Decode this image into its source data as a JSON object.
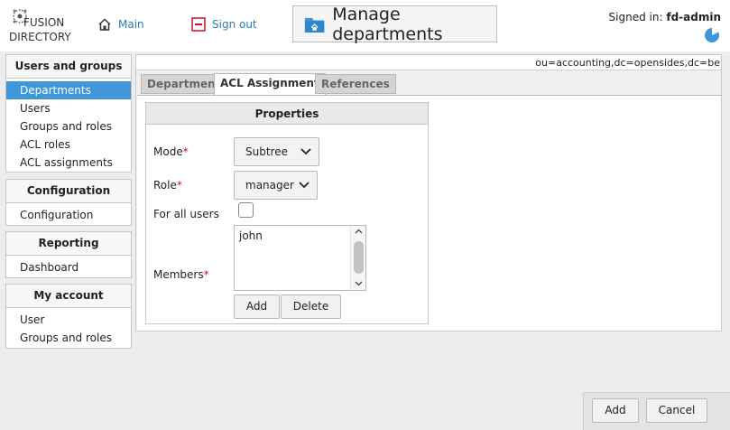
{
  "header": {
    "logo": {
      "line1": "FUSION",
      "line2": "DIRECTORY"
    },
    "main_link": {
      "label": "Main",
      "icon": "home-icon"
    },
    "signout_link": {
      "label": "Sign out",
      "icon": "sign-out-icon"
    },
    "page_title": {
      "label": "Manage departments",
      "icon": "folder-home-icon"
    },
    "signed_in_label": "Signed in:",
    "signed_in_user": "fd-admin",
    "timer_icon": "clock-icon"
  },
  "sidebar": [
    {
      "title": "Users and groups",
      "items": [
        {
          "label": "Departments",
          "active": true
        },
        {
          "label": "Users"
        },
        {
          "label": "Groups and roles"
        },
        {
          "label": "ACL roles"
        },
        {
          "label": "ACL assignments"
        }
      ]
    },
    {
      "title": "Configuration",
      "items": [
        {
          "label": "Configuration"
        }
      ]
    },
    {
      "title": "Reporting",
      "items": [
        {
          "label": "Dashboard"
        }
      ]
    },
    {
      "title": "My account",
      "items": [
        {
          "label": "User"
        },
        {
          "label": "Groups and roles"
        }
      ]
    }
  ],
  "main": {
    "dn": "ou=accounting,dc=opensides,dc=be",
    "tabs": [
      {
        "label": "Department",
        "active": false
      },
      {
        "label": "ACL Assignment",
        "active": true
      },
      {
        "label": "References",
        "active": false
      }
    ],
    "properties": {
      "title": "Properties",
      "mode_label": "Mode",
      "mode_value": "Subtree",
      "role_label": "Role",
      "role_value": "manager",
      "required_mark": "*",
      "for_all_users_label": "For all users",
      "for_all_users_checked": false,
      "members_label": "Members",
      "members": [
        "john"
      ],
      "add_button": "Add",
      "delete_button": "Delete"
    }
  },
  "footer": {
    "add_button": "Add",
    "cancel_button": "Cancel"
  },
  "colors": {
    "accent": "#3f97d8",
    "link": "#2a7bb8",
    "required": "#c8102e"
  }
}
